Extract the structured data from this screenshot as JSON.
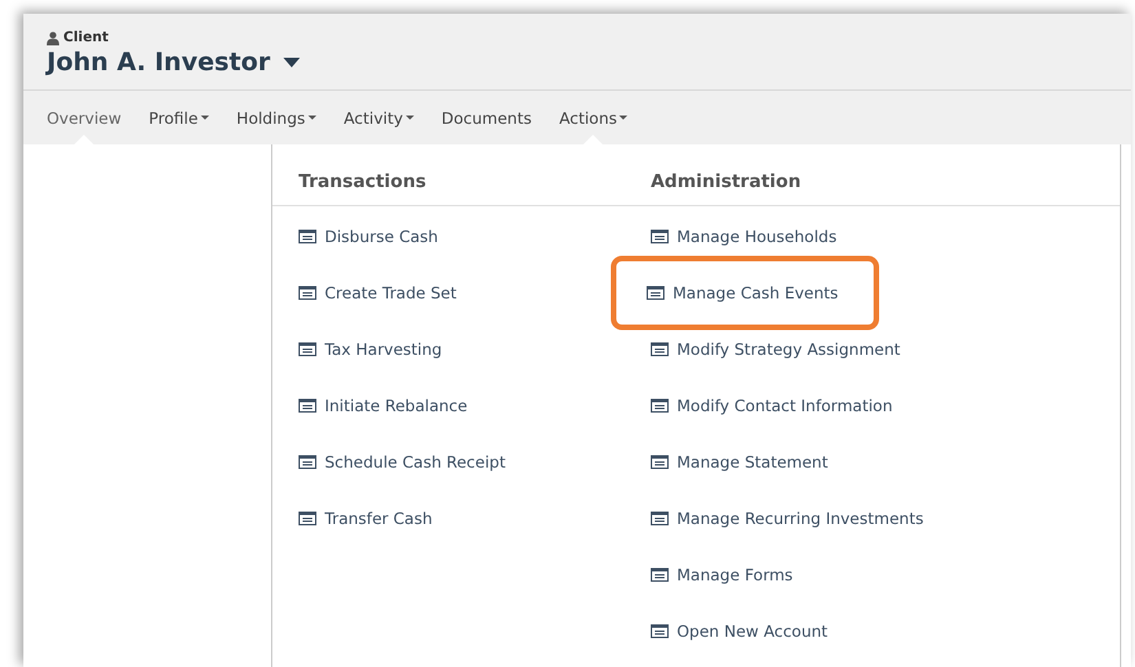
{
  "header": {
    "role": "Client",
    "client_name": "John A. Investor"
  },
  "tabs": [
    {
      "label": "Overview",
      "selected": true,
      "has_menu": false,
      "open": false
    },
    {
      "label": "Profile",
      "selected": false,
      "has_menu": true,
      "open": false
    },
    {
      "label": "Holdings",
      "selected": false,
      "has_menu": true,
      "open": false
    },
    {
      "label": "Activity",
      "selected": false,
      "has_menu": true,
      "open": false
    },
    {
      "label": "Documents",
      "selected": false,
      "has_menu": false,
      "open": false
    },
    {
      "label": "Actions",
      "selected": false,
      "has_menu": true,
      "open": true
    }
  ],
  "actions_menu": {
    "columns": [
      {
        "heading": "Transactions",
        "items": [
          {
            "label": "Disburse Cash",
            "highlighted": false
          },
          {
            "label": "Create Trade Set",
            "highlighted": false
          },
          {
            "label": "Tax Harvesting",
            "highlighted": false
          },
          {
            "label": "Initiate Rebalance",
            "highlighted": false
          },
          {
            "label": "Schedule Cash Receipt",
            "highlighted": false
          },
          {
            "label": "Transfer Cash",
            "highlighted": false
          }
        ]
      },
      {
        "heading": "Administration",
        "items": [
          {
            "label": "Manage Households",
            "highlighted": false
          },
          {
            "label": "Manage Cash Events",
            "highlighted": true
          },
          {
            "label": "Modify Strategy Assignment",
            "highlighted": false
          },
          {
            "label": "Modify Contact Information",
            "highlighted": false
          },
          {
            "label": "Manage Statement",
            "highlighted": false
          },
          {
            "label": "Manage Recurring Investments",
            "highlighted": false
          },
          {
            "label": "Manage Forms",
            "highlighted": false
          },
          {
            "label": "Open New Account",
            "highlighted": false
          }
        ]
      }
    ]
  }
}
